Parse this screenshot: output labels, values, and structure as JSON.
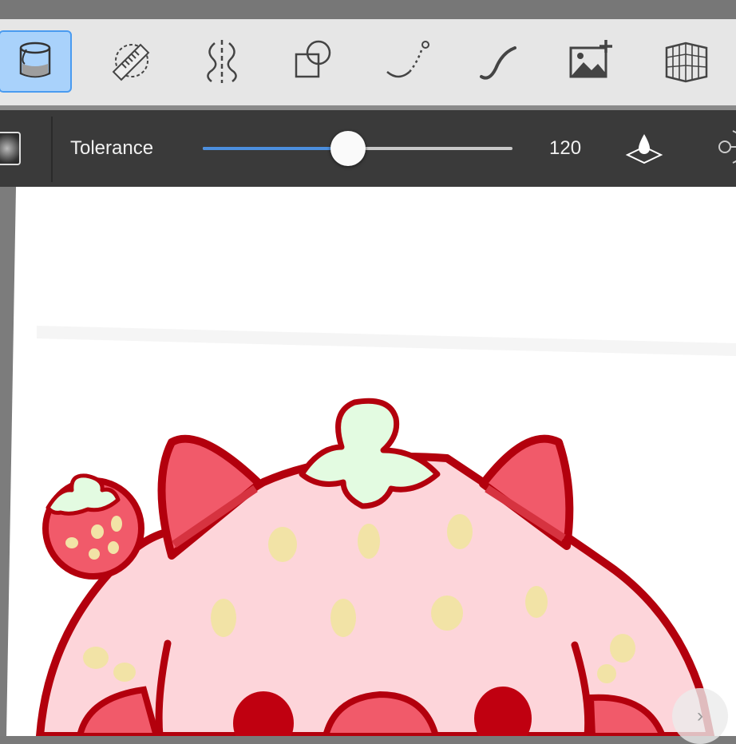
{
  "toolbar": {
    "tools": [
      {
        "name": "fill-bucket",
        "active": true
      },
      {
        "name": "ruler-selection",
        "active": false
      },
      {
        "name": "symmetry",
        "active": false
      },
      {
        "name": "shapes",
        "active": false
      },
      {
        "name": "curve",
        "active": false
      },
      {
        "name": "stroke",
        "active": false
      },
      {
        "name": "add-image",
        "active": false
      },
      {
        "name": "perspective-grid",
        "active": false
      }
    ]
  },
  "options": {
    "tolerance_label": "Tolerance",
    "tolerance_value": "120",
    "tolerance_max": 255,
    "slider_fraction": 0.47,
    "icons": [
      "fill-drop-icon",
      "sample-icon"
    ]
  },
  "canvas": {
    "nav_label": "›"
  },
  "colors": {
    "accent": "#4c8fde",
    "active_tool_bg": "#a9d2fb",
    "outline": "#b3000d",
    "body_pink": "#fdd5da",
    "ear_red": "#f15a6a",
    "leaf_green": "#e3fbe1",
    "seed_yellow": "#f2e3a6"
  }
}
